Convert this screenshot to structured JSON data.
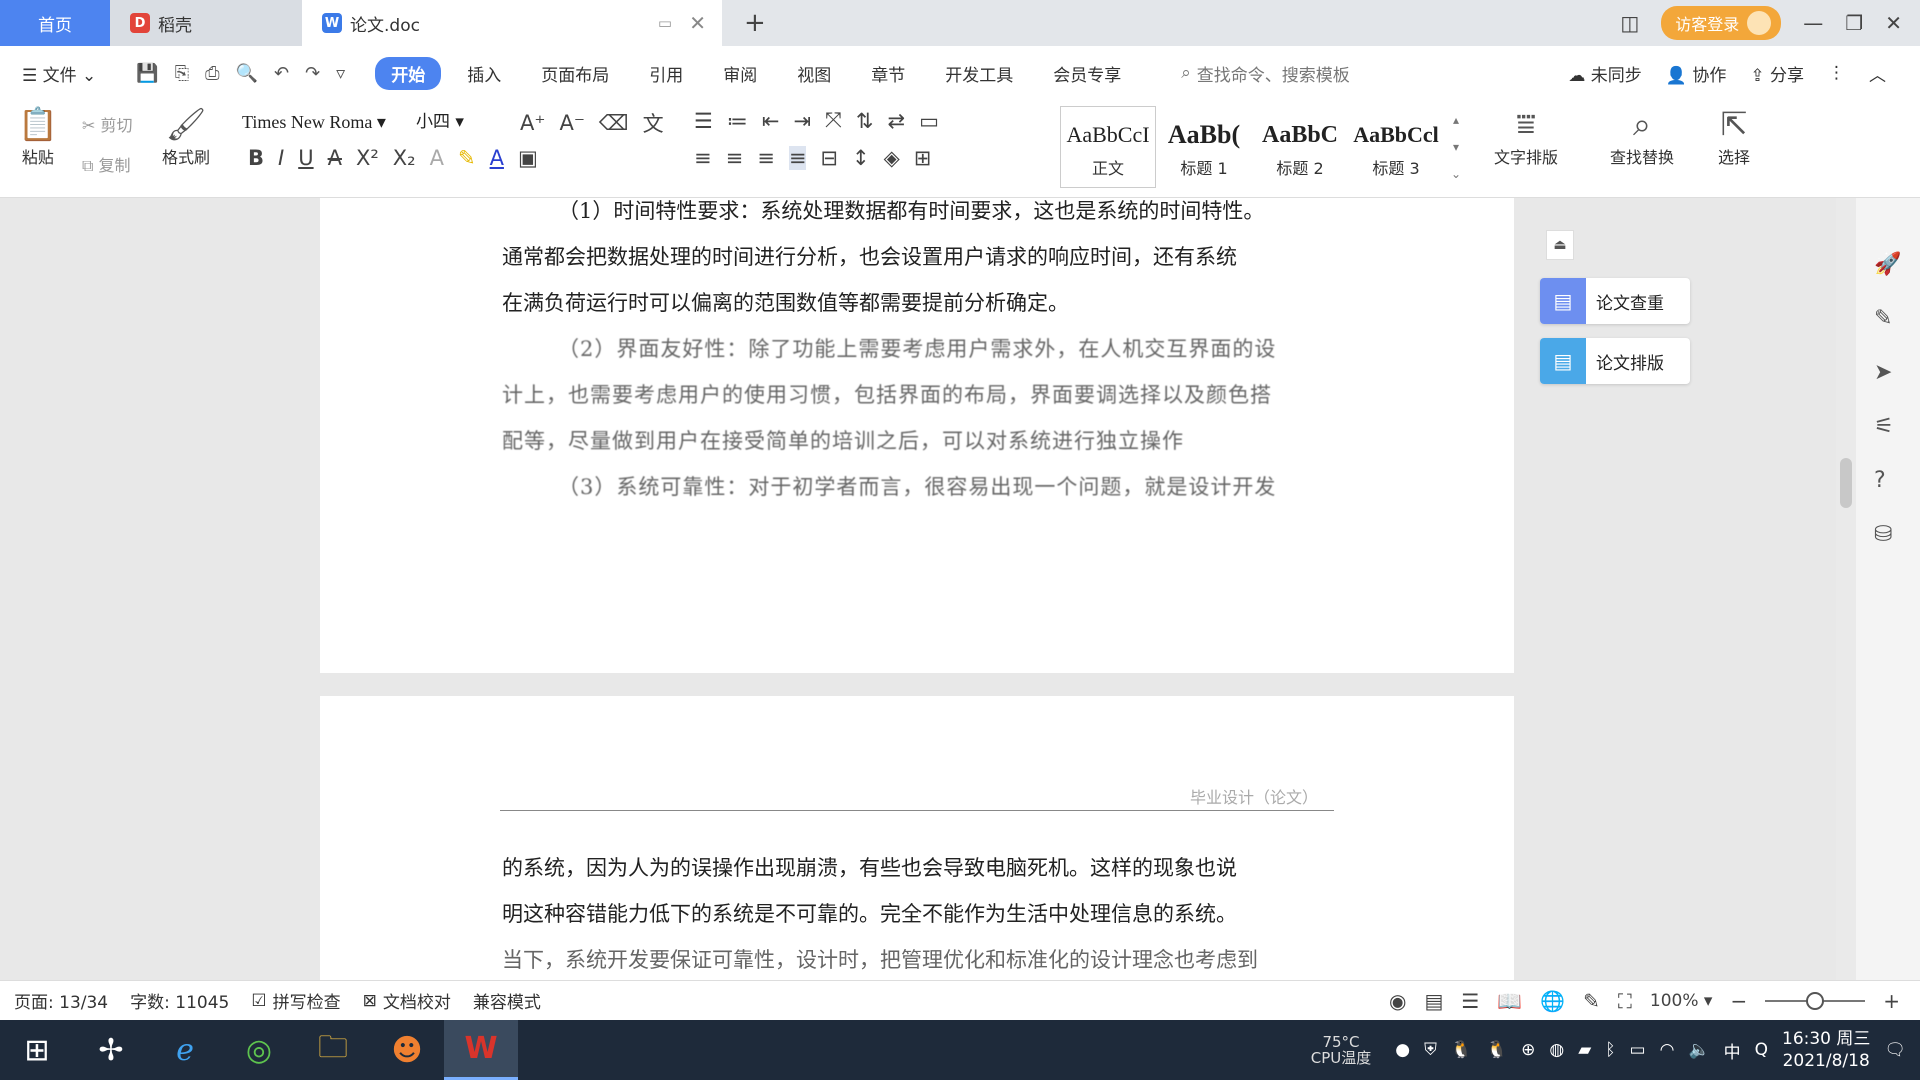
{
  "tabs": {
    "home": "首页",
    "docer": "稻壳",
    "doc": "论文.doc",
    "login": "访客登录"
  },
  "menu": {
    "file": "文件",
    "items": [
      "开始",
      "插入",
      "页面布局",
      "引用",
      "审阅",
      "视图",
      "章节",
      "开发工具",
      "会员专享"
    ],
    "search_placeholder": "查找命令、搜索模板",
    "sync": "未同步",
    "collab": "协作",
    "share": "分享"
  },
  "ribbon": {
    "paste": "粘贴",
    "cut": "剪切",
    "copy": "复制",
    "format_painter": "格式刷",
    "font": "Times New Roma",
    "size": "小四",
    "styles": [
      {
        "preview": "AaBbCcI",
        "label": "正文"
      },
      {
        "preview": "AaBb(",
        "label": "标题 1"
      },
      {
        "preview": "AaBbC",
        "label": "标题 2"
      },
      {
        "preview": "AaBbCcl",
        "label": "标题 3"
      }
    ],
    "text_layout": "文字排版",
    "find_replace": "查找替换",
    "select": "选择"
  },
  "document": {
    "p1_line1": "（1）时间特性要求：系统处理数据都有时间要求，这也是系统的时间特性。",
    "p1_line2": "通常都会把数据处理的时间进行分析，也会设置用户请求的响应时间，还有系统",
    "p1_line3": "在满负荷运行时可以偏离的范围数值等都需要提前分析确定。",
    "p2_line1": "（2）界面友好性：除了功能上需要考虑用户需求外，在人机交互界面的设",
    "p2_line2": "计上，也需要考虑用户的使用习惯，包括界面的布局，界面要调选择以及颜色搭",
    "p2_line3": "配等，尽量做到用户在接受简单的培训之后，可以对系统进行独立操作",
    "p3_line1": "（3）系统可靠性：对于初学者而言，很容易出现一个问题，就是设计开发",
    "page2_header": "毕业设计（论文）",
    "page2_line1": "的系统，因为人为的误操作出现崩溃，有些也会导致电脑死机。这样的现象也说",
    "page2_line2": "明这种容错能力低下的系统是不可靠的。完全不能作为生活中处理信息的系统。",
    "page2_line3": "当下，系统开发要保证可靠性，设计时，把管理优化和标准化的设计理念也考虑到"
  },
  "side_panel": {
    "check": "论文查重",
    "layout": "论文排版"
  },
  "status": {
    "page": "页面: 13/34",
    "words": "字数: 11045",
    "spell": "拼写检查",
    "proof": "文档校对",
    "compat": "兼容模式",
    "zoom": "100%",
    "zoom_level": 0.5
  },
  "taskbar": {
    "cpu_temp": "75°C",
    "cpu_label": "CPU温度",
    "ime": "中",
    "time": "16:30 周三",
    "date": "2021/8/18"
  },
  "colors": {
    "accent": "#4d84f0",
    "login": "#f3a73a",
    "wps_red": "#d9342b"
  }
}
